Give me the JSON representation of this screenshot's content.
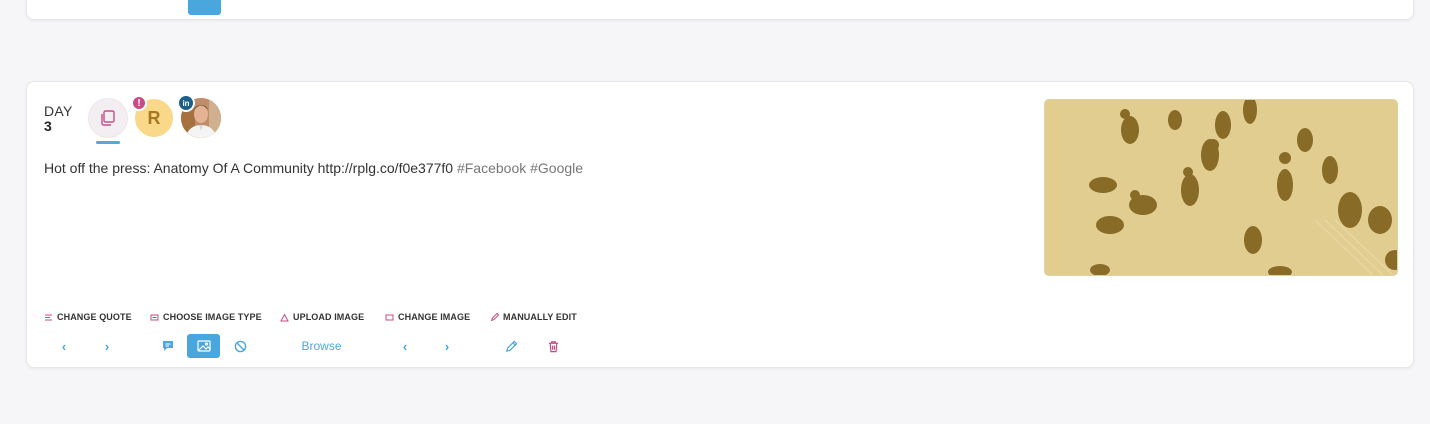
{
  "post": {
    "day_label": "DAY",
    "day_number": "3",
    "avatar_initial": "R",
    "alert_badge": "!",
    "linkedin_badge": "in",
    "text_main": "Hot off the press: Anatomy Of A Community http://rplg.co/f0e377f0",
    "hashtags": "#Facebook #Google"
  },
  "toolbar": {
    "change_quote": "CHANGE QUOTE",
    "choose_image_type": "CHOOSE IMAGE TYPE",
    "upload_image": "UPLOAD IMAGE",
    "change_image": "CHANGE IMAGE",
    "manually_edit": "MANUALLY EDIT",
    "prev": "‹",
    "next": "›",
    "browse": "Browse"
  },
  "colors": {
    "accent_blue": "#4aa7dd",
    "label_pink": "#c94b85",
    "avatar_yellow": "#f9d889",
    "linkedin_blue": "#1d5f8a",
    "image_tint": "#e2cf94"
  },
  "icons": [
    "quote-lines-icon",
    "image-type-icon",
    "upload-icon",
    "change-image-icon",
    "pencil-icon",
    "speech-bubble-icon",
    "image-icon",
    "ban-icon",
    "trash-icon",
    "copy-icon"
  ]
}
